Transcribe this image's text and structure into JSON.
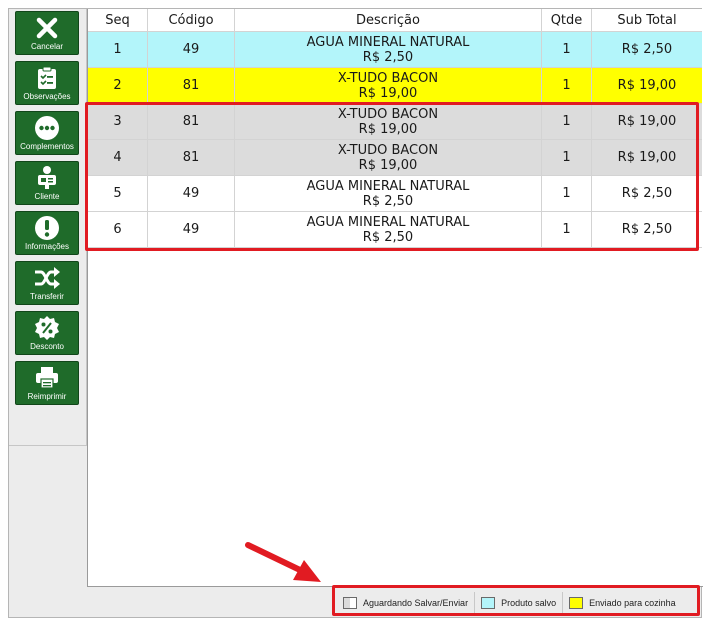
{
  "sidebar": {
    "buttons": [
      {
        "label": "Cancelar",
        "icon": "close-icon"
      },
      {
        "label": "Observações",
        "icon": "clipboard-icon"
      },
      {
        "label": "Complementos",
        "icon": "more-dots-icon"
      },
      {
        "label": "Cliente",
        "icon": "customer-icon"
      },
      {
        "label": "Informações",
        "icon": "info-icon"
      },
      {
        "label": "Transferir",
        "icon": "shuffle-icon"
      },
      {
        "label": "Desconto",
        "icon": "discount-badge-icon"
      },
      {
        "label": "Reimprimir",
        "icon": "printer-icon"
      }
    ]
  },
  "table": {
    "headers": {
      "seq": "Seq",
      "codigo": "Código",
      "descricao": "Descrição",
      "qtde": "Qtde",
      "subtotal": "Sub Total"
    },
    "rows": [
      {
        "seq": "1",
        "codigo": "49",
        "name": "AGUA MINERAL NATURAL",
        "price": "R$ 2,50",
        "qtde": "1",
        "subtotal": "R$ 2,50",
        "bg": "#b3f5fa"
      },
      {
        "seq": "2",
        "codigo": "81",
        "name": "X-TUDO BACON",
        "price": "R$ 19,00",
        "qtde": "1",
        "subtotal": "R$ 19,00",
        "bg": "#ffff00"
      },
      {
        "seq": "3",
        "codigo": "81",
        "name": "X-TUDO BACON",
        "price": "R$ 19,00",
        "qtde": "1",
        "subtotal": "R$ 19,00",
        "bg": "#dcdcdc"
      },
      {
        "seq": "4",
        "codigo": "81",
        "name": "X-TUDO BACON",
        "price": "R$ 19,00",
        "qtde": "1",
        "subtotal": "R$ 19,00",
        "bg": "#dcdcdc"
      },
      {
        "seq": "5",
        "codigo": "49",
        "name": "AGUA MINERAL NATURAL",
        "price": "R$ 2,50",
        "qtde": "1",
        "subtotal": "R$ 2,50",
        "bg": "#ffffff"
      },
      {
        "seq": "6",
        "codigo": "49",
        "name": "AGUA MINERAL NATURAL",
        "price": "R$ 2,50",
        "qtde": "1",
        "subtotal": "R$ 2,50",
        "bg": "#ffffff"
      }
    ]
  },
  "legend": {
    "items": [
      {
        "label": "Aguardando Salvar/Enviar",
        "color": "#dcdcdc",
        "split": true
      },
      {
        "label": "Produto salvo",
        "color": "#b3f5fa"
      },
      {
        "label": "Enviado para cozinha",
        "color": "#ffff00"
      }
    ]
  },
  "colors": {
    "button_green": "#1f6b2a",
    "highlight_red": "#e11b22"
  }
}
